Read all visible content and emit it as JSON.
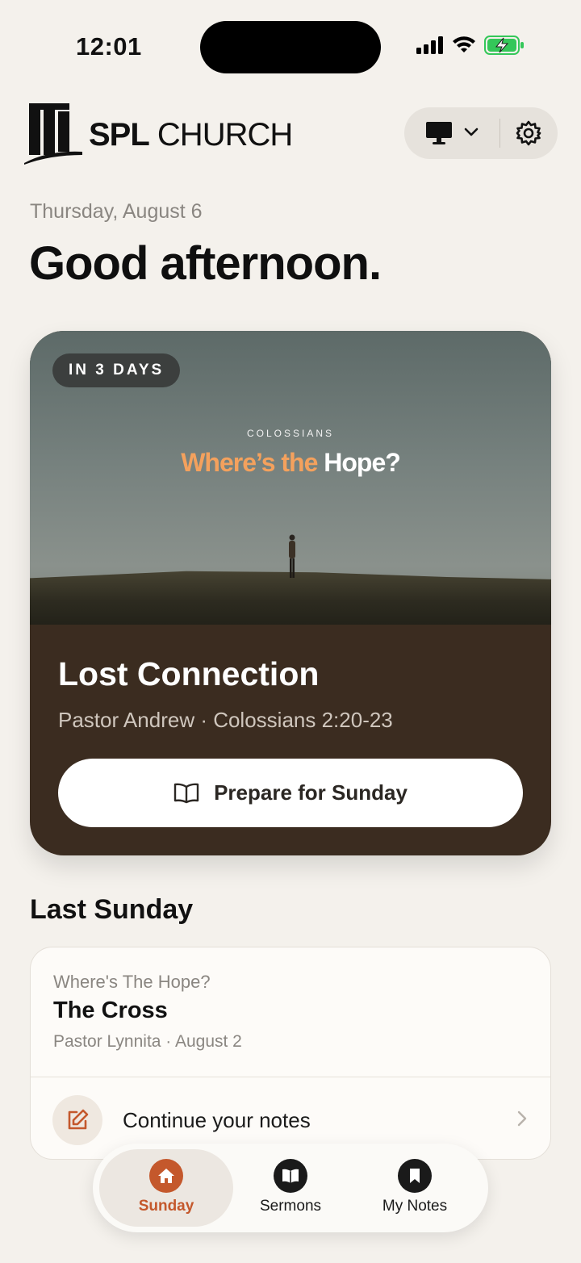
{
  "status_bar": {
    "time": "12:01"
  },
  "header": {
    "logo_bold": "SPL",
    "logo_regular": "CHURCH",
    "display_icon": "monitor-icon",
    "settings_icon": "gear-icon"
  },
  "date": "Thursday, August 6",
  "greeting": "Good afternoon.",
  "upcoming": {
    "badge": "IN 3 DAYS",
    "series_label": "COLOSSIANS",
    "series_title_part1": "Where’s the",
    "series_title_part2": "Hope?",
    "title": "Lost Connection",
    "meta": "Pastor Andrew · Colossians 2:20-23",
    "button_label": "Prepare for Sunday",
    "accent": "#f4a15d"
  },
  "last_sunday": {
    "section_title": "Last Sunday",
    "series": "Where's The Hope?",
    "title": "The Cross",
    "meta": "Pastor Lynnita · August 2",
    "notes_label": "Continue your notes"
  },
  "tabs": [
    {
      "label": "Sunday",
      "icon": "home-icon",
      "active": true
    },
    {
      "label": "Sermons",
      "icon": "book-icon",
      "active": false
    },
    {
      "label": "My Notes",
      "icon": "bookmark-icon",
      "active": false
    }
  ],
  "colors": {
    "brand": "#c4582c",
    "card_dark": "#3b2c20",
    "background": "#f4f1ec"
  }
}
